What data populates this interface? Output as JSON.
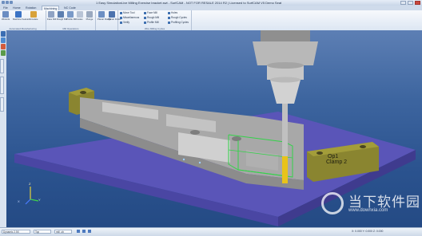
{
  "window": {
    "title": "1 Easy SimulationLive Milling Exercise bracket.swt - SurfCAM - NOT FOR RESALE 2014 R2 | Licensed to SurfCAM V5 Demo Seat"
  },
  "ribbon": {
    "tabs": [
      "File",
      "Home",
      "Rotation",
      "Machining",
      "NC Code"
    ],
    "active_tab": "Machining",
    "advanced_badge": "Advanced",
    "groups": {
      "automation": {
        "label": "Automated Manufacturing",
        "buttons": [
          "Wizards",
          "Machine Feature",
          "Simulate"
        ]
      },
      "mill_ops": {
        "label": "Mill Operations",
        "buttons": [
          "Face Mill",
          "Rough Mill",
          "Profile Mill",
          "Holes",
          "Plunge"
        ]
      },
      "lathe_like": {
        "buttons": [
          "Planar Rough",
          "Planar Finish"
        ]
      },
      "wire": {
        "label": "Wire Milling Cycles",
        "items": [
          "Move Tool",
          "Miscellaneous",
          "Verify",
          "Face Mill",
          "Rough Mill",
          "Profile Mill",
          "Holes",
          "Rough Cycles",
          "Profiling Cycles"
        ]
      }
    }
  },
  "viewport": {
    "clamp_right_line1": "Op1",
    "clamp_right_line2": "Clamp 2",
    "axis_labels": [
      "X",
      "Y",
      "Z"
    ]
  },
  "statusbar": {
    "dynamic_label": "Dynamic 2.5X",
    "view_label": "Top",
    "mode_value": "mill .cb",
    "coords": "X: 0.000  Y: 0.000  Z: 0.000"
  },
  "watermark": {
    "brand_text": "当下软件园",
    "url": "www.downxia.com"
  },
  "colors": {
    "viewport_top": "#5d7fb4",
    "viewport_bottom": "#244a84",
    "fixture_plate": "#5a55b8",
    "part": "#b5b5b5",
    "clamp": "#8a8530",
    "tool_bit": "#e8c31a",
    "toolpath": "#34d24a"
  }
}
